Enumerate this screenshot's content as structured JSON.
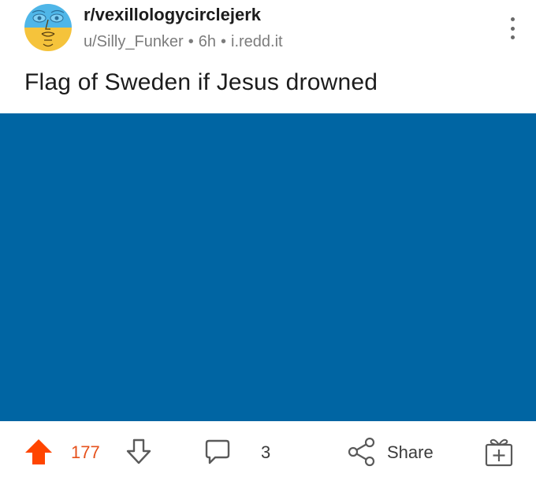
{
  "post": {
    "subreddit": "r/vexillologycirclejerk",
    "author": "u/Silly_Funker",
    "age": "6h",
    "domain": "i.redd.it",
    "separator": "•",
    "title": "Flag of Sweden if Jesus drowned",
    "image_color": "#0065a3"
  },
  "actions": {
    "upvotes": "177",
    "comments": "3",
    "share_label": "Share"
  },
  "colors": {
    "upvote_active": "#ff4500",
    "vote_count": "#e6511b",
    "meta_text": "#7c7c7c",
    "icon_gray": "#5a5a5a"
  },
  "icons": {
    "avatar": "avatar",
    "overflow": "more-vertical-icon",
    "upvote": "upvote-arrow-icon",
    "downvote": "downvote-arrow-icon",
    "comment": "comment-bubble-icon",
    "share": "share-icon",
    "award": "gift-award-icon"
  }
}
